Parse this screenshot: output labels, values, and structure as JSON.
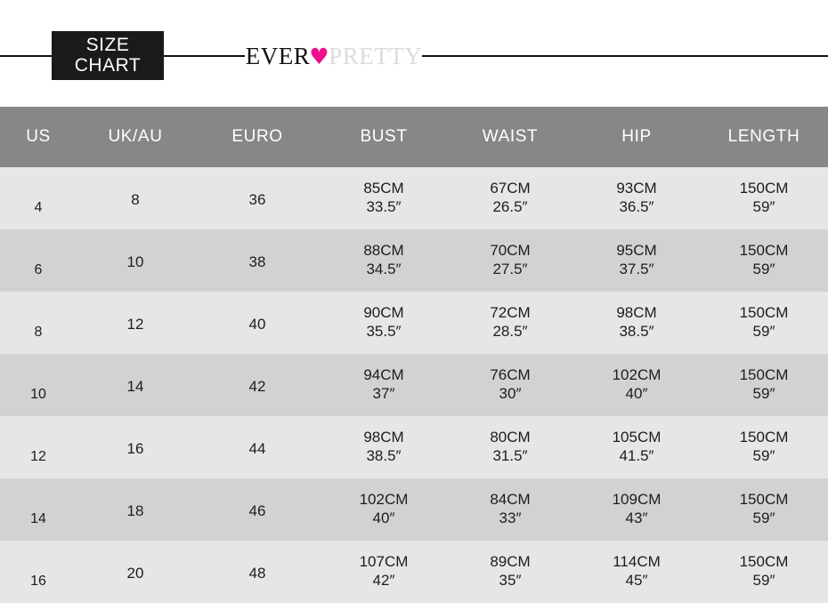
{
  "header": {
    "badge_line1": "SIZE",
    "badge_line2": "CHART",
    "logo": {
      "brand_first": "EVER",
      "heart": "♥",
      "brand_second": "PRETTY",
      "heart_color": "#ee0f90",
      "brand_first_color": "#111111",
      "brand_second_color": "#dcdcdc"
    }
  },
  "table": {
    "header_bg": "#878787",
    "row_bg_odd": "#e6e6e6",
    "row_bg_even": "#d2d2d2",
    "columns": [
      {
        "key": "us",
        "label": "US"
      },
      {
        "key": "uk",
        "label": "UK/AU"
      },
      {
        "key": "euro",
        "label": "EURO"
      },
      {
        "key": "bust",
        "label": "BUST"
      },
      {
        "key": "waist",
        "label": "WAIST"
      },
      {
        "key": "hip",
        "label": "HIP"
      },
      {
        "key": "length",
        "label": "LENGTH"
      }
    ],
    "rows": [
      {
        "us": "4",
        "uk": "8",
        "euro": "36",
        "bust_cm": "85CM",
        "bust_in": "33.5″",
        "waist_cm": "67CM",
        "waist_in": "26.5″",
        "hip_cm": "93CM",
        "hip_in": "36.5″",
        "length_cm": "150CM",
        "length_in": "59″"
      },
      {
        "us": "6",
        "uk": "10",
        "euro": "38",
        "bust_cm": "88CM",
        "bust_in": "34.5″",
        "waist_cm": "70CM",
        "waist_in": "27.5″",
        "hip_cm": "95CM",
        "hip_in": "37.5″",
        "length_cm": "150CM",
        "length_in": "59″"
      },
      {
        "us": "8",
        "uk": "12",
        "euro": "40",
        "bust_cm": "90CM",
        "bust_in": "35.5″",
        "waist_cm": "72CM",
        "waist_in": "28.5″",
        "hip_cm": "98CM",
        "hip_in": "38.5″",
        "length_cm": "150CM",
        "length_in": "59″"
      },
      {
        "us": "10",
        "uk": "14",
        "euro": "42",
        "bust_cm": "94CM",
        "bust_in": "37″",
        "waist_cm": "76CM",
        "waist_in": "30″",
        "hip_cm": "102CM",
        "hip_in": "40″",
        "length_cm": "150CM",
        "length_in": "59″"
      },
      {
        "us": "12",
        "uk": "16",
        "euro": "44",
        "bust_cm": "98CM",
        "bust_in": "38.5″",
        "waist_cm": "80CM",
        "waist_in": "31.5″",
        "hip_cm": "105CM",
        "hip_in": "41.5″",
        "length_cm": "150CM",
        "length_in": "59″"
      },
      {
        "us": "14",
        "uk": "18",
        "euro": "46",
        "bust_cm": "102CM",
        "bust_in": "40″",
        "waist_cm": "84CM",
        "waist_in": "33″",
        "hip_cm": "109CM",
        "hip_in": "43″",
        "length_cm": "150CM",
        "length_in": "59″"
      },
      {
        "us": "16",
        "uk": "20",
        "euro": "48",
        "bust_cm": "107CM",
        "bust_in": "42″",
        "waist_cm": "89CM",
        "waist_in": "35″",
        "hip_cm": "114CM",
        "hip_in": "45″",
        "length_cm": "150CM",
        "length_in": "59″"
      }
    ]
  }
}
